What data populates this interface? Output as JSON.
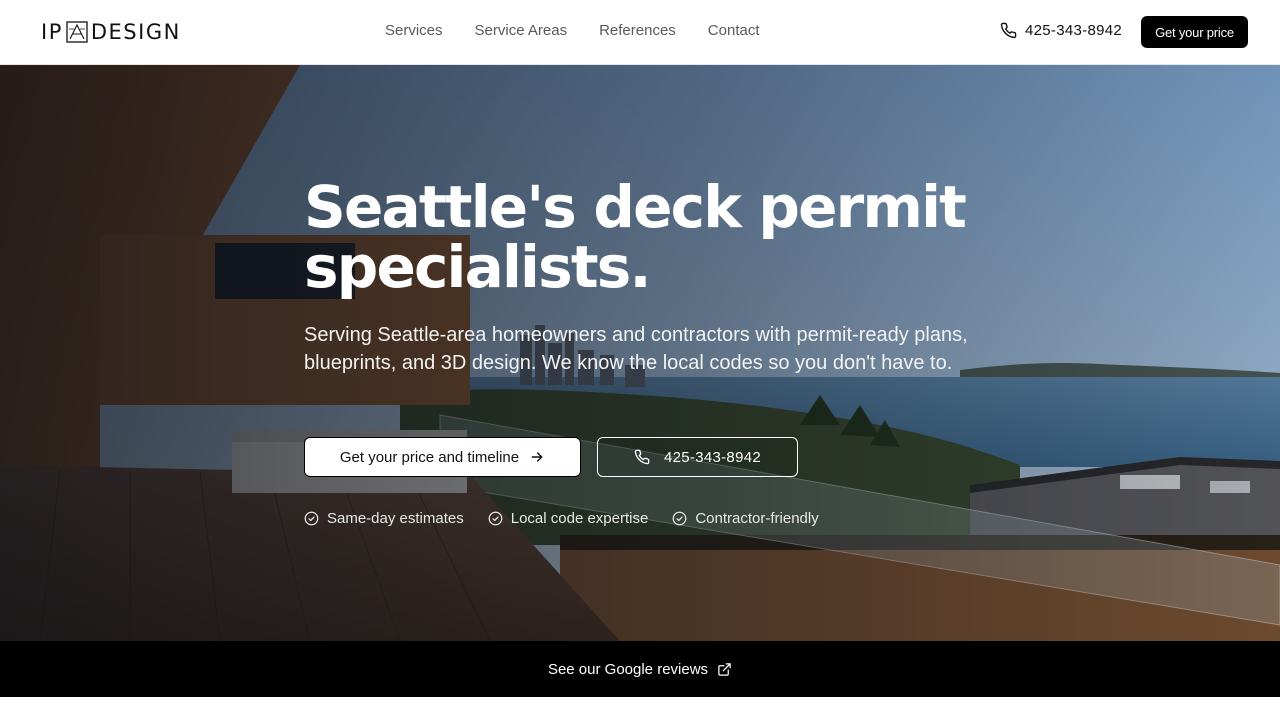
{
  "header": {
    "logo_left": "IP",
    "logo_right": "DESIGN",
    "nav": [
      "Services",
      "Service Areas",
      "References",
      "Contact"
    ],
    "phone": "425-343-8942",
    "cta": "Get your price"
  },
  "hero": {
    "title_line1": "Seattle's deck permit",
    "title_line2": "specialists.",
    "subtitle": "Serving Seattle-area homeowners and contractors with permit-ready plans, blueprints, and 3D design. We know the local codes so you don't have to.",
    "primary_button": "Get your price and timeline",
    "secondary_button": "425-343-8942",
    "features": [
      "Same-day estimates",
      "Local code expertise",
      "Contractor-friendly"
    ]
  },
  "reviews": {
    "label": "See our Google reviews"
  },
  "colors": {
    "accent": "#000000",
    "hero_overlay": "#1a2230",
    "sky": "#8fb3d8",
    "water": "#4a7aa0"
  },
  "icons": {
    "phone": "phone-icon",
    "arrow": "arrow-right-icon",
    "check": "check-circle-icon",
    "external": "external-link-icon"
  }
}
